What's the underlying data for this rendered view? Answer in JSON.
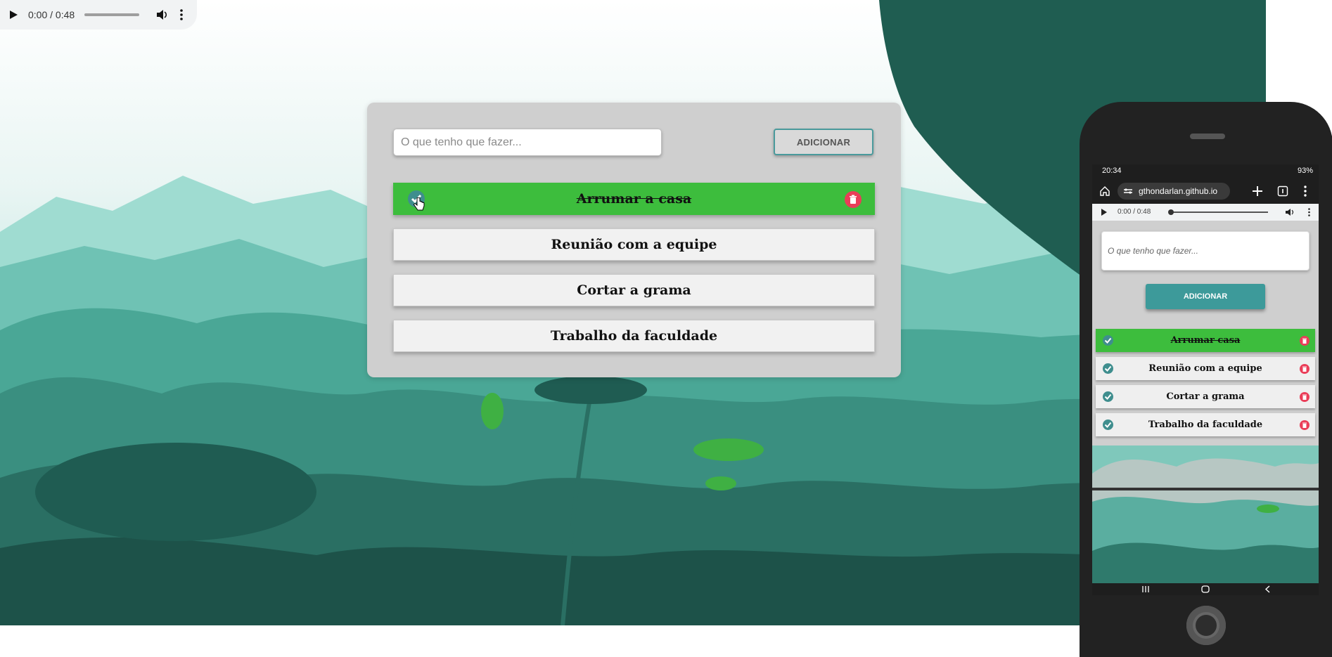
{
  "audio": {
    "time": "0:00 / 0:48",
    "play_icon": "play-icon",
    "volume_icon": "volume-icon",
    "more_icon": "more-vert-icon"
  },
  "todo": {
    "input_placeholder": "O que tenho que fazer...",
    "add_label": "ADICIONAR",
    "tasks": [
      {
        "text": "Arrumar a casa",
        "done": true
      },
      {
        "text": "Reunião com a equipe",
        "done": false
      },
      {
        "text": "Cortar a grama",
        "done": false
      },
      {
        "text": "Trabalho da faculdade",
        "done": false
      }
    ]
  },
  "phone": {
    "status": {
      "time": "20:34",
      "battery": "93%"
    },
    "url": "gthondarlan.github.io",
    "audio_time": "0:00 / 0:48",
    "input_placeholder": "O que tenho que fazer...",
    "add_label": "ADICIONAR",
    "tasks": [
      {
        "text": "Arrumar casa",
        "done": true
      },
      {
        "text": "Reunião com a equipe",
        "done": false
      },
      {
        "text": "Cortar a grama",
        "done": false
      },
      {
        "text": "Trabalho da faculdade",
        "done": false
      }
    ]
  },
  "colors": {
    "done": "#3dbd3d",
    "accent": "#3d9a9a",
    "delete": "#ea3d58",
    "card": "#cfcfcf"
  }
}
